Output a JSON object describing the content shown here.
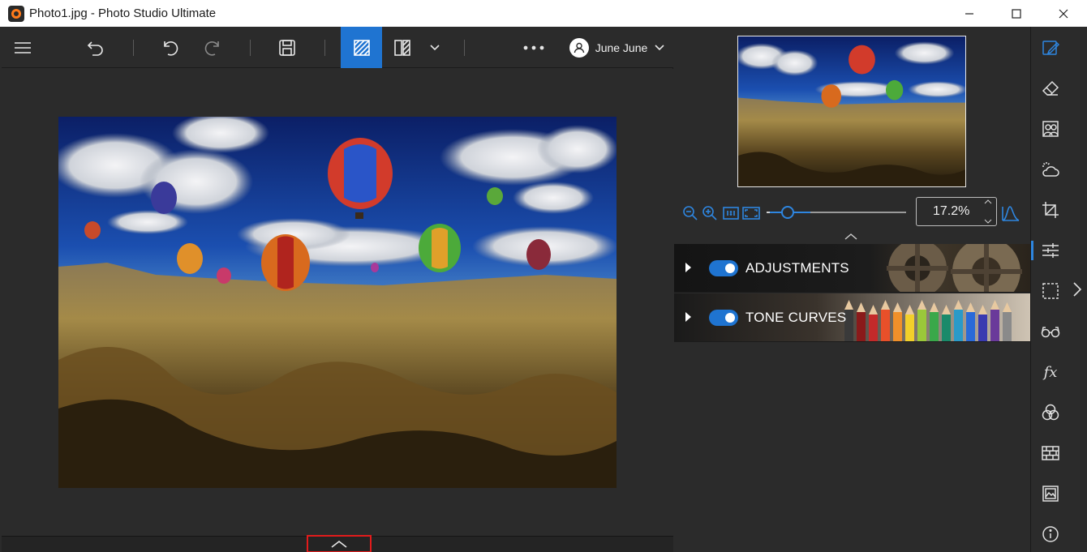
{
  "window": {
    "title": "Photo1.jpg - Photo Studio Ultimate",
    "controls": [
      "minimize-icon",
      "maximize-icon",
      "close-icon"
    ]
  },
  "toolbar": {
    "items": [
      "menu-icon",
      "undo-icon",
      "rotate-left-icon",
      "rotate-right-icon",
      "save-icon",
      "compare-split-icon",
      "compare-side-icon",
      "chevron-down-icon",
      "more-icon"
    ],
    "user": {
      "name": "June June",
      "icon": "user-icon"
    }
  },
  "panel": {
    "zoom": {
      "value": "17.2%",
      "slider_fraction": 0.3
    },
    "sections": [
      {
        "label": "ADJUSTMENTS",
        "enabled": true
      },
      {
        "label": "TONE CURVES",
        "enabled": true
      }
    ]
  },
  "side_tools": [
    "edit-icon",
    "eraser-icon",
    "portrait-icon",
    "weather-icon",
    "crop-icon",
    "sliders-icon",
    "selection-icon",
    "glasses-icon",
    "fx-icon",
    "color-mix-icon",
    "texture-icon",
    "image-frame-icon",
    "info-icon"
  ],
  "side_tools_fx_label": "fx",
  "colors": {
    "accent": "#1f74d1",
    "highlight_border": "#e21b1b",
    "background": "#2b2b2b"
  }
}
